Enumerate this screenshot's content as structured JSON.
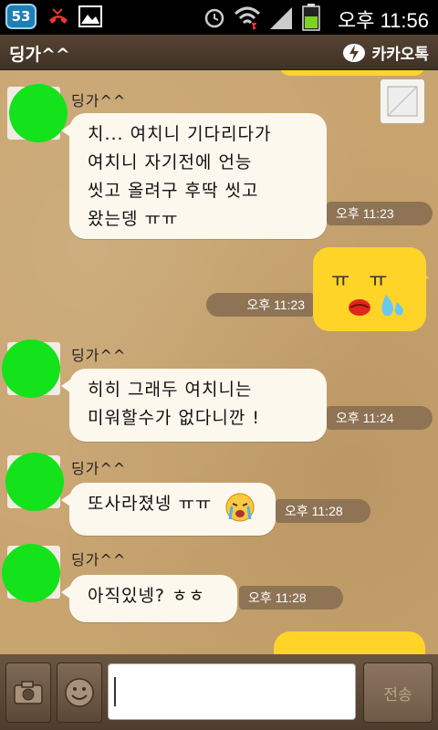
{
  "status_bar": {
    "badge": "53",
    "time": "오후 11:56"
  },
  "header": {
    "title": "딩가^^",
    "brand": "카카오톡"
  },
  "messages": [
    {
      "name": "딩가^^",
      "lines": [
        "치... 여치니 기다리다가",
        "여치니 자기전에 언능",
        "씻고 올려구 후딱 씻고",
        "왔는뎅 ㅠㅠ"
      ],
      "time": "오후 11:23"
    },
    {
      "sticker_text": "ㅠ   ㅠ",
      "time": "오후 11:23"
    },
    {
      "name": "딩가^^",
      "lines": [
        "히히 그래두 여치니는",
        "미워할수가 없다니깐 !"
      ],
      "time": "오후 11:24"
    },
    {
      "name": "딩가^^",
      "lines": [
        "또사라졌넹 ㅠㅠ"
      ],
      "time": "오후 11:28"
    },
    {
      "name": "딩가^^",
      "lines": [
        "아직있넹? ㅎㅎ"
      ],
      "time": "오후 11:28"
    }
  ],
  "input": {
    "placeholder": "",
    "send_label": "전송"
  },
  "colors": {
    "avatar": "#14e21b",
    "bubble_mine": "#ffd428",
    "bubble_theirs": "#fdf8ee",
    "timestamp": "#8e7355"
  }
}
